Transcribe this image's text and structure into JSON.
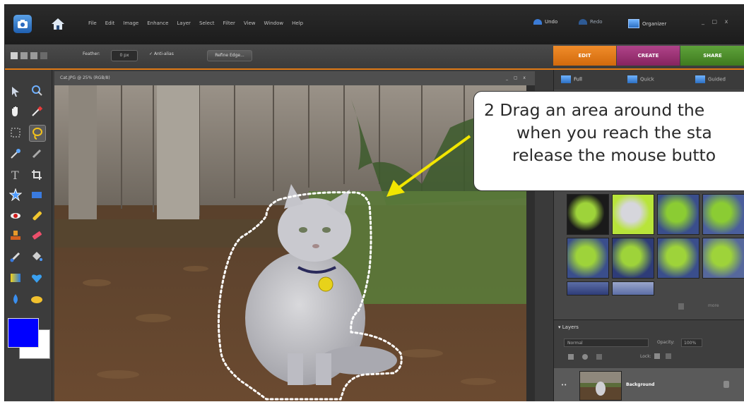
{
  "menubar": {
    "menus": [
      "File",
      "Edit",
      "Image",
      "Enhance",
      "Layer",
      "Select",
      "Filter",
      "View",
      "Window",
      "Help"
    ],
    "undo": "Undo",
    "redo": "Redo",
    "organizer": "Organizer",
    "window_controls": "_ ▢ x"
  },
  "options": {
    "feather_label": "Feather:",
    "feather_value": "0 px",
    "antialias_label": "Anti-alias",
    "refine_label": "Refine Edge..."
  },
  "mode_tabs": [
    "EDIT",
    "CREATE",
    "SHARE"
  ],
  "panel_tabs": [
    "Full",
    "Quick",
    "Guided"
  ],
  "document": {
    "title": "Cat.JPG @ 25% (RGB/8)",
    "controls": "_ ▢ x"
  },
  "layers": {
    "header": "Layers",
    "blend_mode": "Normal",
    "opacity_label": "Opacity:",
    "opacity_value": "100%",
    "lock_label": "Lock:",
    "layer_name": "Background",
    "more_label": "more"
  },
  "callout": {
    "line1": "2  Drag an area around the",
    "line2": "when you reach the sta",
    "line3": "release the mouse butto"
  },
  "colors": {
    "foreground": "#0000ff",
    "background": "#ffffff",
    "edit_tab": "#e07a16",
    "create_tab": "#9a2f74",
    "share_tab": "#4e8a2a",
    "arrow": "#f2e600"
  }
}
